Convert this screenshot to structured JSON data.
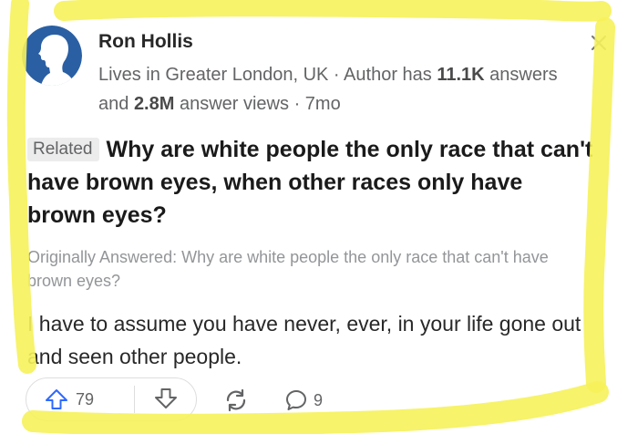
{
  "author": {
    "name": "Ron Hollis",
    "credential_location": "Lives in Greater London, UK",
    "credential_sep1": " · ",
    "credential_prefix": "Author has ",
    "answers_count": "11.1K",
    "answers_word": " answers and ",
    "views_count": "2.8M",
    "views_word": " answer views",
    "credential_sep2": " · ",
    "time_ago": "7mo"
  },
  "question": {
    "badge": "Related",
    "text": "Why are white people the only race that can't have brown eyes, when other races only have brown eyes?"
  },
  "original": {
    "text": "Originally Answered: Why are white people the only race that can't have brown eyes?"
  },
  "answer": {
    "text": "I have to assume you have never, ever, in your life gone out and seen other people."
  },
  "actions": {
    "upvotes": "79",
    "comments": "9"
  },
  "colors": {
    "highlight": "#f6f25a",
    "avatar_bg": "#2a5fa3",
    "text": "#282829",
    "muted": "#636466"
  },
  "icons": {
    "close": "close-icon",
    "upvote": "upvote-arrow-icon",
    "downvote": "downvote-arrow-icon",
    "share": "share-icon",
    "comment": "comment-icon",
    "avatar": "profile-silhouette-icon"
  }
}
